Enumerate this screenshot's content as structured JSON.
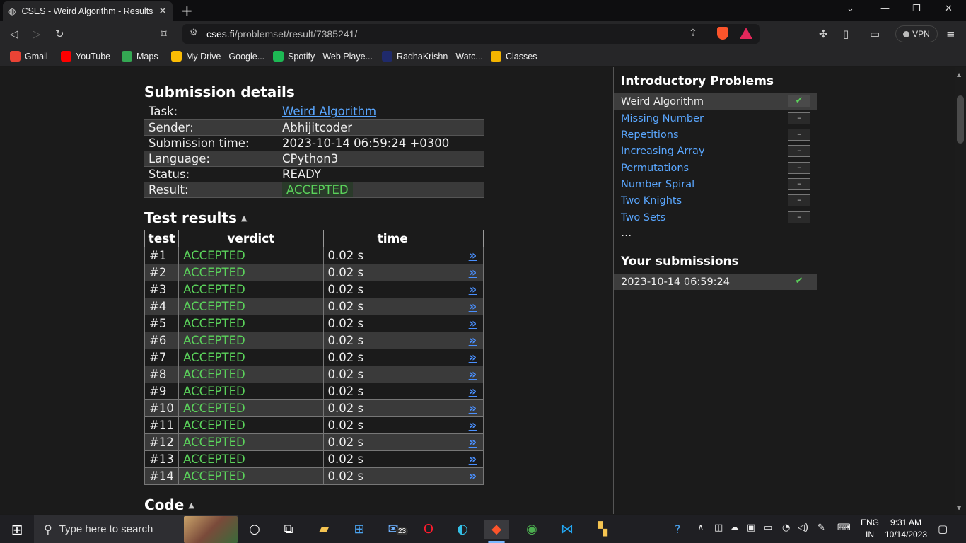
{
  "browser": {
    "tab_title": "CSES - Weird Algorithm - Results",
    "tab_close": "✕",
    "new_tab": "+",
    "url_host": "cses.fi",
    "url_path": "/problemset/result/7385241/",
    "vpn_label": "VPN",
    "bookmarks": [
      {
        "label": "Gmail",
        "icon": "gmail-icon",
        "color": "#ea4335"
      },
      {
        "label": "YouTube",
        "icon": "youtube-icon",
        "color": "#ff0000"
      },
      {
        "label": "Maps",
        "icon": "maps-icon",
        "color": "#34a853"
      },
      {
        "label": "My Drive - Google...",
        "icon": "drive-icon",
        "color": "#fbbc04"
      },
      {
        "label": "Spotify - Web Playe...",
        "icon": "spotify-icon",
        "color": "#1db954"
      },
      {
        "label": "RadhaKrishn - Watc...",
        "icon": "hotstar-icon",
        "color": "#1f2a6b"
      },
      {
        "label": "Classes",
        "icon": "classroom-icon",
        "color": "#f4b400"
      }
    ]
  },
  "page": {
    "details_heading": "Submission details",
    "details": [
      {
        "key": "Task:",
        "value": "Weird Algorithm"
      },
      {
        "key": "Sender:",
        "value": "Abhijitcoder"
      },
      {
        "key": "Submission time:",
        "value": "2023-10-14 06:59:24 +0300"
      },
      {
        "key": "Language:",
        "value": "CPython3"
      },
      {
        "key": "Status:",
        "value": "READY"
      },
      {
        "key": "Result:",
        "value": "ACCEPTED"
      }
    ],
    "tests_heading": "Test results",
    "tests_columns": [
      "test",
      "verdict",
      "time",
      ""
    ],
    "tests": [
      {
        "test": "#1",
        "verdict": "ACCEPTED",
        "time": "0.02 s"
      },
      {
        "test": "#2",
        "verdict": "ACCEPTED",
        "time": "0.02 s"
      },
      {
        "test": "#3",
        "verdict": "ACCEPTED",
        "time": "0.02 s"
      },
      {
        "test": "#4",
        "verdict": "ACCEPTED",
        "time": "0.02 s"
      },
      {
        "test": "#5",
        "verdict": "ACCEPTED",
        "time": "0.02 s"
      },
      {
        "test": "#6",
        "verdict": "ACCEPTED",
        "time": "0.02 s"
      },
      {
        "test": "#7",
        "verdict": "ACCEPTED",
        "time": "0.02 s"
      },
      {
        "test": "#8",
        "verdict": "ACCEPTED",
        "time": "0.02 s"
      },
      {
        "test": "#9",
        "verdict": "ACCEPTED",
        "time": "0.02 s"
      },
      {
        "test": "#10",
        "verdict": "ACCEPTED",
        "time": "0.02 s"
      },
      {
        "test": "#11",
        "verdict": "ACCEPTED",
        "time": "0.02 s"
      },
      {
        "test": "#12",
        "verdict": "ACCEPTED",
        "time": "0.02 s"
      },
      {
        "test": "#13",
        "verdict": "ACCEPTED",
        "time": "0.02 s"
      },
      {
        "test": "#14",
        "verdict": "ACCEPTED",
        "time": "0.02 s"
      }
    ],
    "test_link_glyph": "»",
    "code_heading": "Code"
  },
  "sidebar": {
    "problems_heading": "Introductory Problems",
    "problems": [
      {
        "name": "Weird Algorithm",
        "status": "✔",
        "current": true
      },
      {
        "name": "Missing Number",
        "status": "–",
        "current": false
      },
      {
        "name": "Repetitions",
        "status": "–",
        "current": false
      },
      {
        "name": "Increasing Array",
        "status": "–",
        "current": false
      },
      {
        "name": "Permutations",
        "status": "–",
        "current": false
      },
      {
        "name": "Number Spiral",
        "status": "–",
        "current": false
      },
      {
        "name": "Two Knights",
        "status": "–",
        "current": false
      },
      {
        "name": "Two Sets",
        "status": "–",
        "current": false
      }
    ],
    "more": "...",
    "submissions_heading": "Your submissions",
    "submissions": [
      {
        "time": "2023-10-14 06:59:24",
        "status": "✔"
      }
    ]
  },
  "taskbar": {
    "search_placeholder": "Type here to search",
    "mail_badge": "23",
    "lang_line1": "ENG",
    "lang_line2": "IN",
    "time": "9:31 AM",
    "date": "10/14/2023"
  },
  "colors": {
    "accepted": "#5bd35b",
    "link": "#5aa7ff",
    "background": "#1b1b1b"
  }
}
